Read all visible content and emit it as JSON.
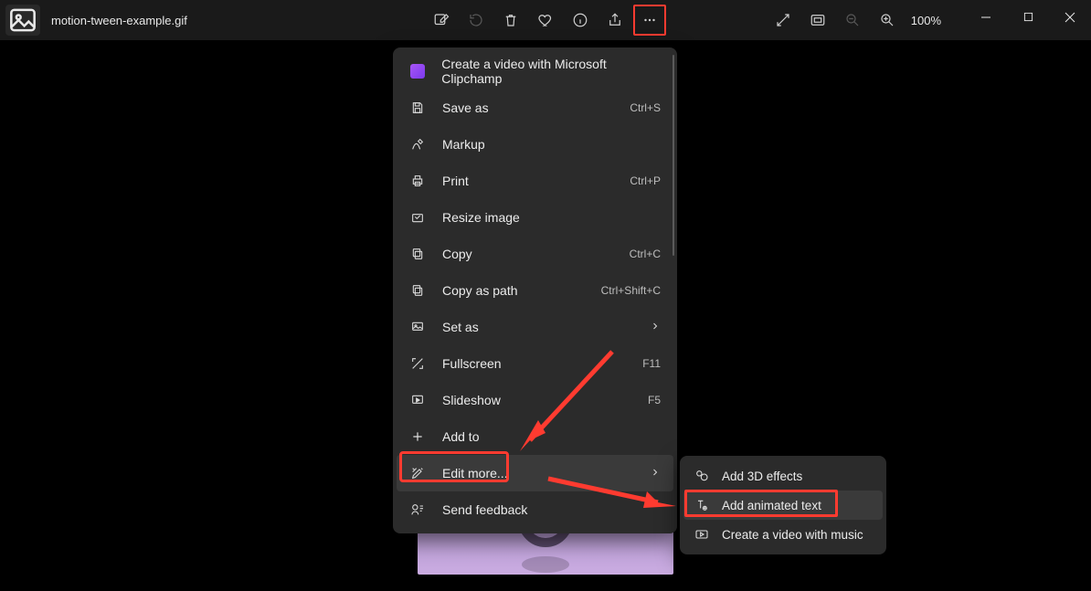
{
  "filename": "motion-tween-example.gif",
  "zoom": "100%",
  "menu": {
    "items": [
      {
        "label": "Create a video with Microsoft Clipchamp",
        "shortcut": ""
      },
      {
        "label": "Save as",
        "shortcut": "Ctrl+S"
      },
      {
        "label": "Markup",
        "shortcut": ""
      },
      {
        "label": "Print",
        "shortcut": "Ctrl+P"
      },
      {
        "label": "Resize image",
        "shortcut": ""
      },
      {
        "label": "Copy",
        "shortcut": "Ctrl+C"
      },
      {
        "label": "Copy as path",
        "shortcut": "Ctrl+Shift+C"
      },
      {
        "label": "Set as",
        "shortcut": "",
        "submenu": true
      },
      {
        "label": "Fullscreen",
        "shortcut": "F11"
      },
      {
        "label": "Slideshow",
        "shortcut": "F5"
      },
      {
        "label": "Add to",
        "shortcut": ""
      },
      {
        "label": "Edit more...",
        "shortcut": "",
        "submenu": true
      },
      {
        "label": "Send feedback",
        "shortcut": ""
      }
    ]
  },
  "submenu": {
    "items": [
      {
        "label": "Add 3D effects"
      },
      {
        "label": "Add animated text"
      },
      {
        "label": "Create a video with music"
      }
    ]
  }
}
